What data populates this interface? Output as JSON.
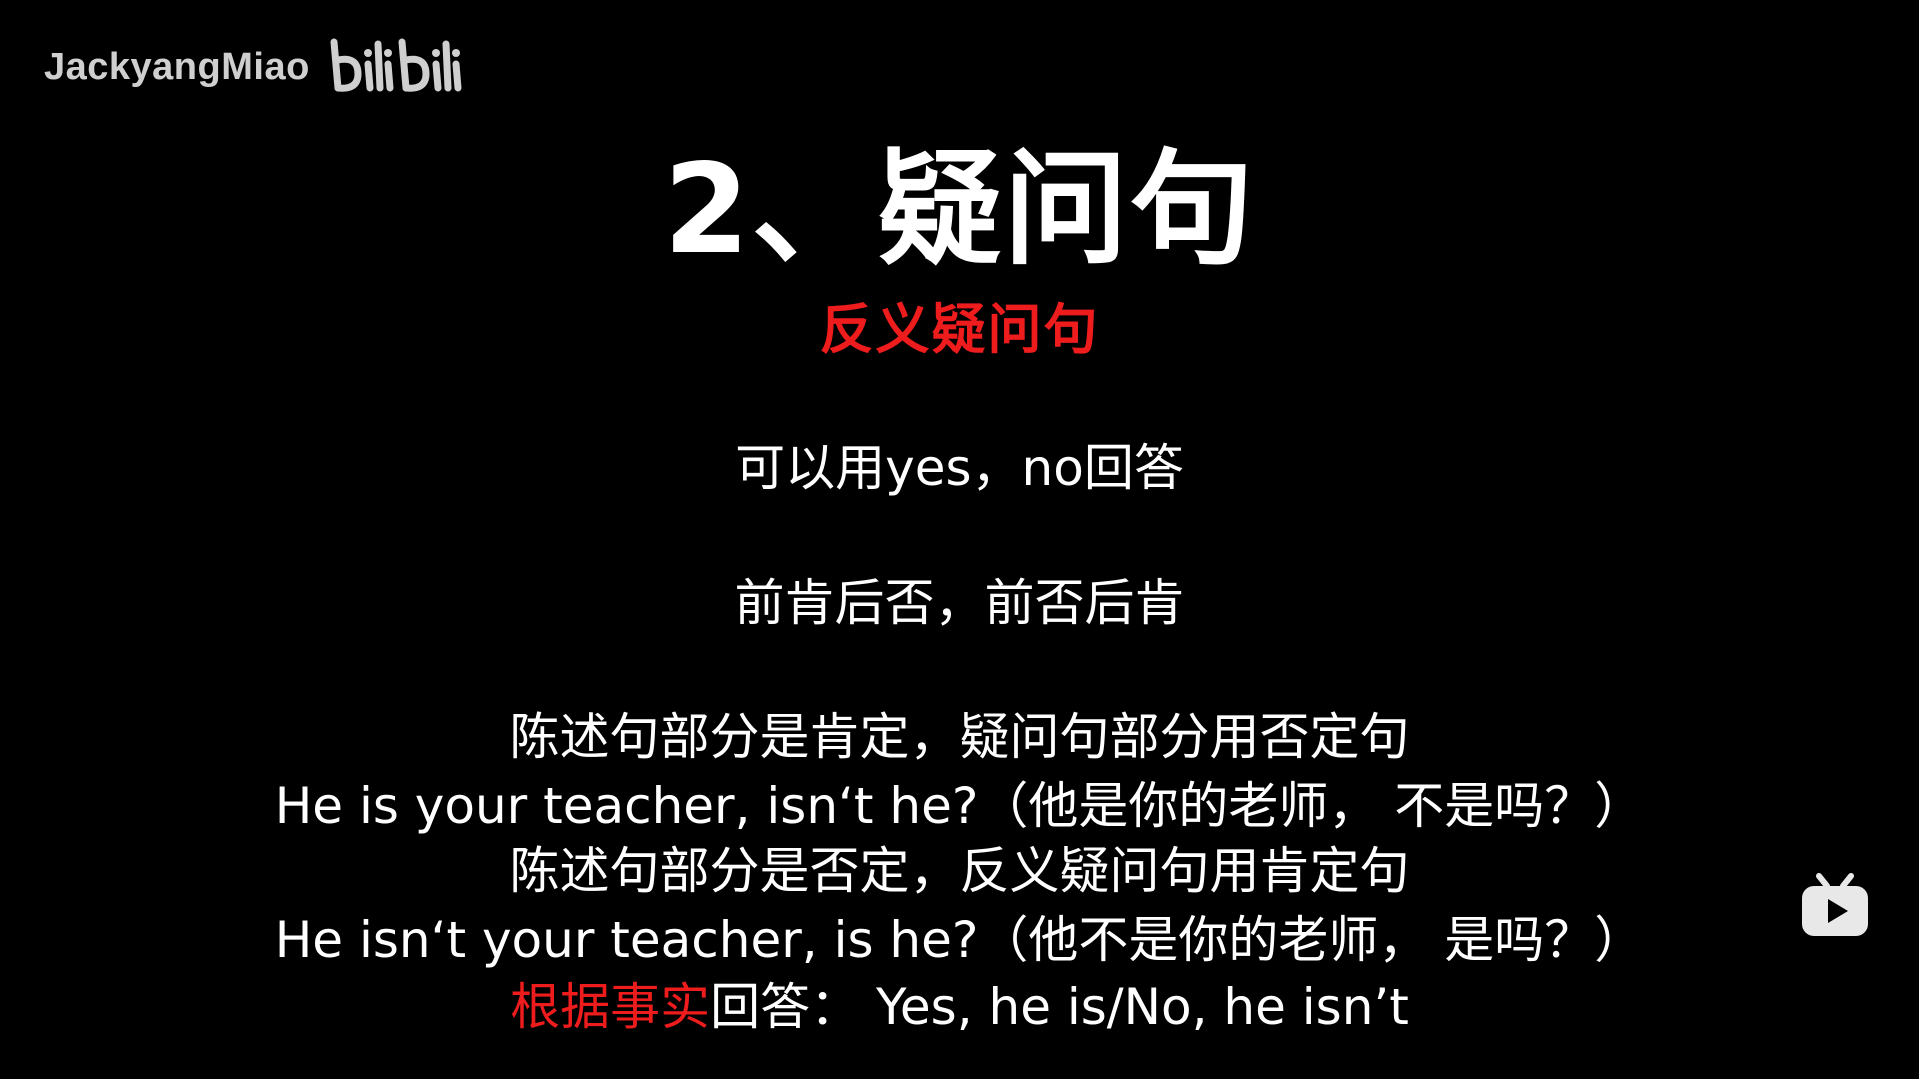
{
  "watermark": {
    "username": "JackyangMiao",
    "brand": "bilibili",
    "brand_icon": "bilibili-logo-icon"
  },
  "slide": {
    "title": "2、疑问句",
    "subtitle": "反义疑问句",
    "line1": "可以用yes，no回答",
    "line2": "前肯后否，前否后肯",
    "line3": "陈述句部分是肯定，疑问句部分用否定句",
    "line4": "He is your teacher, isn‘t he?（他是你的老师，  不是吗？）",
    "line5": "陈述句部分是否定，反义疑问句用肯定句",
    "line6": "He isn‘t your teacher, is he?（他不是你的老师，  是吗？）",
    "line7_highlight": "根据事实",
    "line7_rest": "回答：  Yes, he is/No, he isn’t"
  },
  "player": {
    "icon": "bilibili-play-icon"
  },
  "colors": {
    "background": "#000000",
    "text": "#ffffff",
    "accent_red": "#ee1c1c"
  }
}
